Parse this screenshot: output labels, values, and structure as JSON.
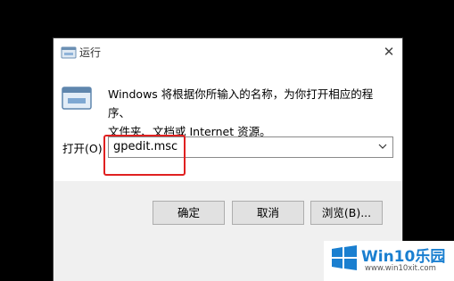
{
  "dialog": {
    "title": "运行",
    "title_icon": "run-icon",
    "close_icon": "close-icon",
    "close_glyph": "✕",
    "description_line1": "Windows 将根据你所输入的名称，为你打开相应的程序、",
    "description_line2": "文件夹、文档或 Internet 资源。",
    "open_label": "打开(O):",
    "command_value": "gpedit.msc",
    "dropdown_icon": "chevron-down-icon"
  },
  "buttons": {
    "ok_label": "确定",
    "cancel_label": "取消",
    "browse_label": "浏览(B)..."
  },
  "annotation": {
    "highlight_color": "#e02020"
  },
  "watermark": {
    "brand": "Win10乐园",
    "url": "www.win10xit.com"
  },
  "colors": {
    "background": "#000000",
    "dialog": "#ffffff",
    "footer": "#f0f0f0",
    "button": "#e1e1e1",
    "brand_blue": "#1a7fd0"
  }
}
